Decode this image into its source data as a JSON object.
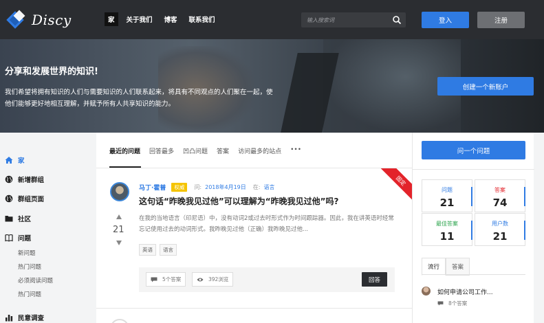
{
  "brand": {
    "name": "Discy"
  },
  "nav": {
    "items": [
      {
        "label": "家",
        "active": true
      },
      {
        "label": "关于我们",
        "active": false
      },
      {
        "label": "博客",
        "active": false
      },
      {
        "label": "联系我们",
        "active": false
      }
    ],
    "search_placeholder": "输入搜索词",
    "login_label": "登入",
    "register_label": "注册"
  },
  "hero": {
    "title": "分享和发展世界的知识!",
    "description": "我们希望将拥有知识的人们与需要知识的人们联系起来，将具有不同观点的人们聚在一起，使他们能够更好地相互理解，并赋予所有人共享知识的能力。",
    "cta_label": "创建一个新账户"
  },
  "sidebar": {
    "items": [
      {
        "label": "家",
        "icon": "home-icon",
        "active": true
      },
      {
        "label": "新增群组",
        "icon": "globe-icon",
        "active": false
      },
      {
        "label": "群组页面",
        "icon": "globe-icon",
        "active": false
      },
      {
        "label": "社区",
        "icon": "folder-icon",
        "active": false
      },
      {
        "label": "问题",
        "icon": "book-icon",
        "active": false
      }
    ],
    "sub_items": [
      "新问题",
      "热门问题",
      "必须阅读问题",
      "热门问题"
    ],
    "last_item": {
      "label": "民意调查",
      "icon": "poll-icon"
    }
  },
  "main": {
    "tabs": [
      "最近的问题",
      "回答最多",
      "凹凸问题",
      "答案",
      "访问最多的站点"
    ],
    "more_label": "•••",
    "question": {
      "ribbon": "固定",
      "author": "马丁·霍普",
      "badge": "权威",
      "asked_label": "问:",
      "asked_date": "2018年4月19日",
      "in_label": "在:",
      "category": "语言",
      "title": "这句话“昨晚我见过他”可以理解为“昨晚我见过他”吗?",
      "body": "在我的当地语言（印尼语）中，没有动词2或过去时形式作为时间跟踪器。因此，我在讲英语时经常忘记使用过去的动词形式。我昨晚见过他（正确）我昨晚见过他...",
      "votes": "21",
      "tags": [
        "英语",
        "语言"
      ],
      "answers_label": "5个答案",
      "views_label": "392浏览",
      "answer_button": "回答"
    }
  },
  "right": {
    "ask_label": "问一个问题",
    "stats": [
      {
        "label": "问题",
        "value": "21",
        "color": "#2f7be3"
      },
      {
        "label": "答案",
        "value": "74",
        "color": "#e3232a"
      },
      {
        "label": "最佳答案",
        "value": "11",
        "color": "#2da44e"
      },
      {
        "label": "用户数",
        "value": "21",
        "color": "#2f7be3"
      }
    ],
    "tabs": [
      "流行",
      "答案"
    ],
    "hot": {
      "title": "如何申请公司工作...",
      "answers": "8个答案"
    }
  }
}
